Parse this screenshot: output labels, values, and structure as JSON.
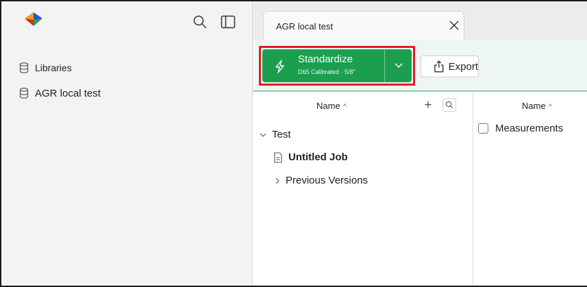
{
  "app": {
    "logo_icon": "prism-logo-icon",
    "search_icon": "search-icon",
    "sidebar_toggle_icon": "sidebar-toggle-icon"
  },
  "sidebar": {
    "items": [
      {
        "label": "Libraries",
        "icon": "database-icon"
      },
      {
        "label": "AGR local test",
        "icon": "database-icon"
      }
    ]
  },
  "tabs": [
    {
      "label": "AGR local test",
      "close_icon": "close-icon"
    }
  ],
  "toolbar": {
    "standardize_label": "Standardize",
    "standardize_sub": "D65 Calibrated · 5/8\"",
    "standardize_icon": "lightning-icon",
    "dropdown_icon": "chevron-down-icon",
    "export_label": "Export",
    "export_icon": "share-icon",
    "accent": "#1b9f4f",
    "highlight": "#e21b24"
  },
  "left_panel": {
    "header": "Name",
    "sort_icon": "chevron-up-icon",
    "add_label": "+",
    "tree": [
      {
        "label": "Test",
        "expanded": true
      },
      {
        "label": "Untitled Job",
        "icon": "document-icon"
      },
      {
        "label": "Previous Versions",
        "expanded": false
      }
    ]
  },
  "right_panel": {
    "header": "Name",
    "rows": [
      {
        "label": "Measurements",
        "checked": false
      }
    ]
  }
}
